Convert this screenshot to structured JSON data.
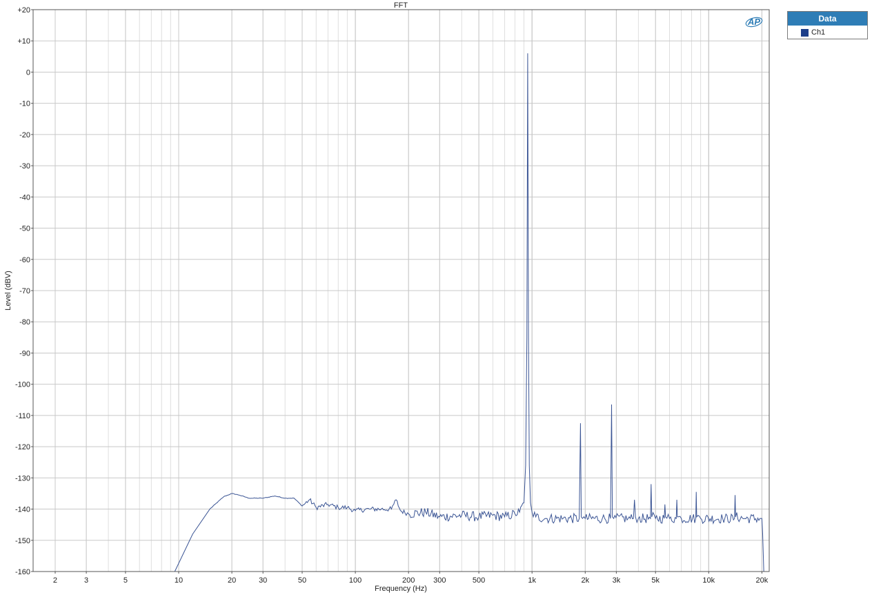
{
  "chart_data": {
    "type": "line",
    "title": "FFT",
    "xlabel": "Frequency (Hz)",
    "ylabel": "Level (dBV)",
    "x_scale": "log",
    "xlim": [
      1.5,
      22000
    ],
    "ylim": [
      -160,
      20
    ],
    "grid": true,
    "legend_position": "top-right, outside plot",
    "x_tick_values": [
      2,
      3,
      5,
      10,
      20,
      30,
      50,
      100,
      200,
      300,
      500,
      1000,
      2000,
      3000,
      5000,
      10000,
      20000
    ],
    "x_tick_labels": [
      "2",
      "3",
      "5",
      "10",
      "20",
      "30",
      "50",
      "100",
      "200",
      "300",
      "500",
      "1k",
      "2k",
      "3k",
      "5k",
      "10k",
      "20k"
    ],
    "y_tick_values": [
      20,
      10,
      0,
      -10,
      -20,
      -30,
      -40,
      -50,
      -60,
      -70,
      -80,
      -90,
      -100,
      -110,
      -120,
      -130,
      -140,
      -150,
      -160
    ],
    "y_tick_labels": [
      "+20",
      "+10",
      "0",
      "-10",
      "-20",
      "-30",
      "-40",
      "-50",
      "-60",
      "-70",
      "-80",
      "-90",
      "-100",
      "-110",
      "-120",
      "-130",
      "-140",
      "-150",
      "-160"
    ],
    "series": [
      {
        "name": "Ch1",
        "color": "#3a5494",
        "x": [
          9.5,
          12,
          15,
          18,
          20,
          22,
          25,
          30,
          35,
          40,
          45,
          50,
          55,
          60,
          70,
          80,
          90,
          100,
          120,
          140,
          160,
          170,
          180,
          200,
          250,
          300,
          400,
          500,
          600,
          700,
          800,
          850,
          900,
          920,
          935,
          945,
          955,
          965,
          980,
          1000,
          1050,
          1200,
          1500,
          1850,
          1880,
          1900,
          1930,
          2000,
          2500,
          2780,
          2820,
          2850,
          2900,
          3500,
          3750,
          3800,
          3850,
          4000,
          4680,
          4720,
          4760,
          5000,
          5600,
          5650,
          5700,
          6000,
          6550,
          6600,
          6650,
          7000,
          8450,
          8500,
          8550,
          9000,
          12000,
          14000,
          14100,
          14200,
          16000,
          19500,
          20000,
          20200,
          20500
        ],
        "y": [
          -160,
          -148,
          -140,
          -136,
          -135,
          -135.5,
          -136.5,
          -136.5,
          -135.8,
          -136.5,
          -136.5,
          -139,
          -137,
          -139.5,
          -138.5,
          -139.5,
          -139.5,
          -140.5,
          -140,
          -140,
          -140,
          -137,
          -140.5,
          -141.5,
          -141,
          -142.5,
          -142,
          -142.5,
          -142,
          -142.5,
          -141.5,
          -141,
          -138,
          -126,
          -85,
          6,
          -85,
          -126,
          -138,
          -141,
          -142.5,
          -143,
          -143,
          -143,
          -112.5,
          -142.5,
          -143,
          -143,
          -143,
          -143,
          -106.5,
          -142.5,
          -143,
          -143,
          -143,
          -137,
          -142.5,
          -143,
          -143,
          -132,
          -142.5,
          -143,
          -143,
          -138.5,
          -142.5,
          -143,
          -143,
          -137,
          -142.5,
          -143,
          -143,
          -134.5,
          -142.5,
          -143,
          -143,
          -143,
          -135.5,
          -142.5,
          -143,
          -143,
          -143,
          -148,
          -160
        ]
      }
    ]
  },
  "logo": {
    "text": "AP",
    "color": "#2e7db6"
  },
  "legend": {
    "header": "Data",
    "items": [
      {
        "label": "Ch1",
        "color": "#1c3e8a"
      }
    ]
  }
}
